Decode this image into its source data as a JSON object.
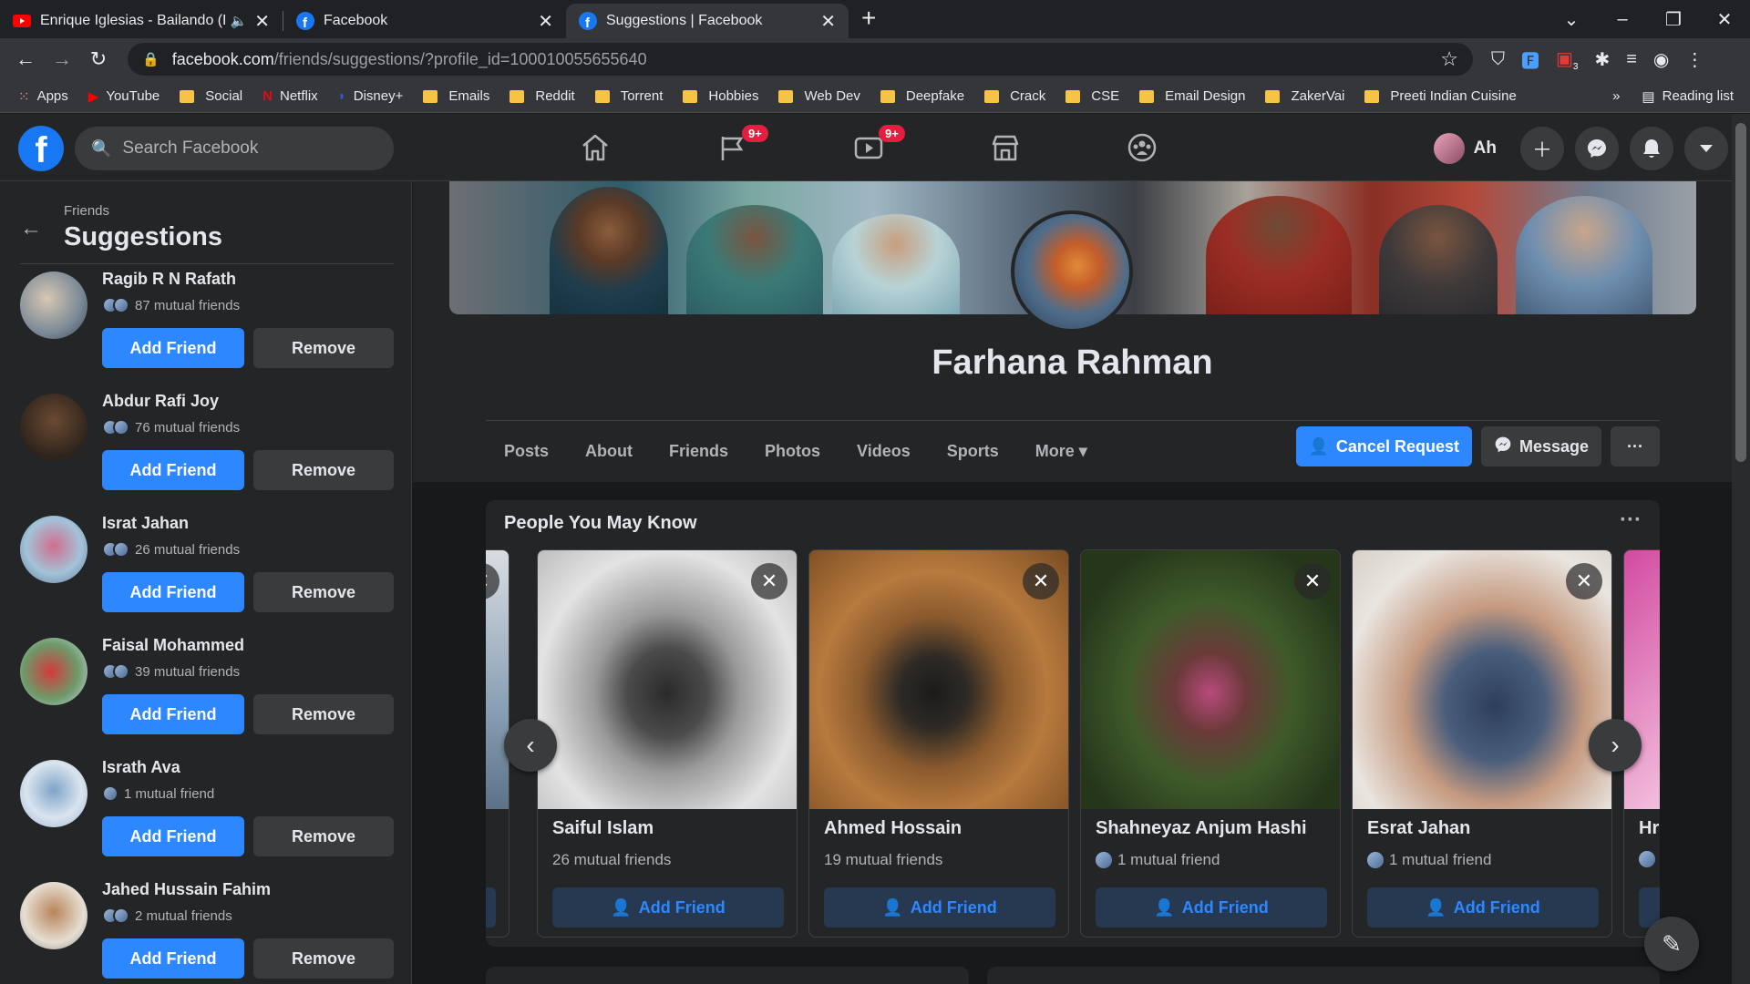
{
  "browser": {
    "tabs": [
      {
        "title": "Enrique Iglesias - Bailando (E",
        "audio": "speaker-icon",
        "favicon_color": "#ff0000"
      },
      {
        "title": "Facebook",
        "favicon_color": "#1877f2"
      },
      {
        "title": "Suggestions | Facebook",
        "favicon_color": "#1877f2",
        "active": true
      }
    ],
    "new_tab": "+",
    "url_host": "facebook.com",
    "url_path": "/friends/suggestions/?profile_id=100010055655640",
    "bookmarks": [
      "Apps",
      "YouTube",
      "Social",
      "Netflix",
      "Disney+",
      "Emails",
      "Reddit",
      "Torrent",
      "Hobbies",
      "Web Dev",
      "Deepfake",
      "Crack",
      "CSE",
      "Email Design",
      "ZakerVai",
      "Preeti Indian Cuisine"
    ],
    "bookmarks_overflow": "»",
    "reading_list": "Reading list",
    "ext_badge": "3"
  },
  "fb": {
    "logo": "f",
    "search_placeholder": "Search Facebook",
    "nav": [
      {
        "icon": "home-icon",
        "badge": ""
      },
      {
        "icon": "pages-flag-icon",
        "badge": "9+"
      },
      {
        "icon": "watch-video-icon",
        "badge": "9+"
      },
      {
        "icon": "marketplace-icon",
        "badge": ""
      },
      {
        "icon": "groups-icon",
        "badge": ""
      }
    ],
    "profile_short": "Ah",
    "accent": "#2d88ff"
  },
  "sidebar": {
    "breadcrumb": "Friends",
    "title": "Suggestions",
    "add_label": "Add Friend",
    "remove_label": "Remove",
    "items": [
      {
        "name": "Ragib R N Rafath",
        "mutual": "87 mutual friends"
      },
      {
        "name": "Abdur Rafi Joy",
        "mutual": "76 mutual friends"
      },
      {
        "name": "Israt Jahan",
        "mutual": "26 mutual friends"
      },
      {
        "name": "Faisal Mohammed",
        "mutual": "39 mutual friends"
      },
      {
        "name": "Israth Ava",
        "mutual": "1 mutual friend"
      },
      {
        "name": "Jahed Hussain Fahim",
        "mutual": "2 mutual friends"
      }
    ]
  },
  "profile": {
    "name": "Farhana Rahman",
    "tabs": [
      "Posts",
      "About",
      "Friends",
      "Photos",
      "Videos",
      "Sports",
      "More"
    ],
    "more_caret": "▾",
    "cancel_request": "Cancel Request",
    "message": "Message",
    "more_dots": "···"
  },
  "pymk": {
    "title": "People You May Know",
    "more": "···",
    "add_label": "Add Friend",
    "cards": [
      {
        "name": "Saiful Islam",
        "mutual": "26 mutual friends",
        "show_avatar": false
      },
      {
        "name": "Ahmed Hossain",
        "mutual": "19 mutual friends",
        "show_avatar": false
      },
      {
        "name": "Shahneyaz Anjum Hashi",
        "mutual": "1 mutual friend",
        "show_avatar": true
      },
      {
        "name": "Esrat Jahan",
        "mutual": "1 mutual friend",
        "show_avatar": true
      },
      {
        "name": "Hri",
        "mutual": "",
        "show_avatar": true
      }
    ]
  }
}
